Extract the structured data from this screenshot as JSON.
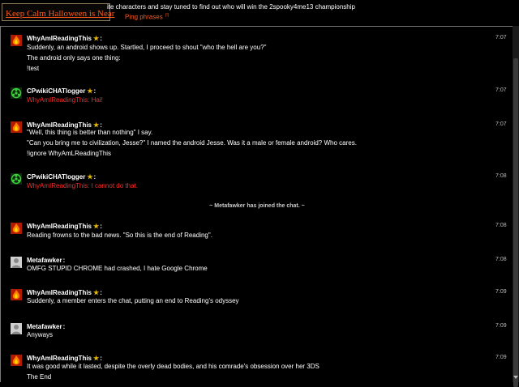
{
  "header": {
    "logo_text": "Keep Calm Halloween is Near",
    "motd": "ite characters and stay tuned to find out who will win the 2spooky4me13 championship",
    "ping_label": "Ping phrases",
    "ping_count": "(!)"
  },
  "messages": [
    {
      "author": "WhyAmIReadingThis",
      "time": "7:07",
      "avatar": "flame-avatar",
      "lines": [
        "Suddenly, an android shows up. Startled, I proceed to shout \"who the hell are you?\"",
        "The android only says one thing:",
        "!test"
      ]
    },
    {
      "author": "CPwikiCHATlogger",
      "time": "7:07",
      "avatar": "biohazard-avatar",
      "lines": [
        "WhyAmIReadingThis: Hai!"
      ]
    },
    {
      "author": "WhyAmIReadingThis",
      "time": "7:07",
      "avatar": "flame-avatar",
      "lines": [
        "\"Well, this thing is better than nothing\" I say.",
        "\"Can you bring me to civilization, Jesse?\" I named the android Jesse. Was it a male or female android? Who cares.",
        "!ignore WhyAmLReadingThis"
      ]
    },
    {
      "author": "CPwikiCHATlogger",
      "time": "7:08",
      "avatar": "biohazard-avatar",
      "lines": [
        "WhyAmIReadingThis: I cannot do that."
      ]
    },
    {
      "author": "WhyAmIReadingThis",
      "time": "7:08",
      "avatar": "flame-avatar",
      "lines": [
        "Reading frowns to the bad news. \"So this is the end of Reading\"."
      ]
    },
    {
      "author": "Metafawker",
      "time": "7:08",
      "avatar": "default-avatar",
      "lines": [
        "OMFG STUPID CHROME had crashed, I hate Google Chrome"
      ]
    },
    {
      "author": "WhyAmIReadingThis",
      "time": "7:09",
      "avatar": "flame-avatar",
      "lines": [
        "Suddenly, a member enters the chat, putting an end to Reading's odyssey"
      ]
    },
    {
      "author": "Metafawker",
      "time": "7:09",
      "avatar": "default-avatar",
      "lines": [
        "Anyways"
      ]
    },
    {
      "author": "WhyAmIReadingThis",
      "time": "7:09",
      "avatar": "flame-avatar",
      "lines": [
        "It was good while it lasted, despite the overly dead bodies, and his comrade's obsession over her 3DS",
        "The End"
      ]
    }
  ],
  "inline_alert": "~ Metafawker has joined the chat. ~",
  "colors": {
    "background": "#000000",
    "accent": "#ff5a1a",
    "bot_message": "#ff2a2a",
    "star": "#e6b800"
  }
}
